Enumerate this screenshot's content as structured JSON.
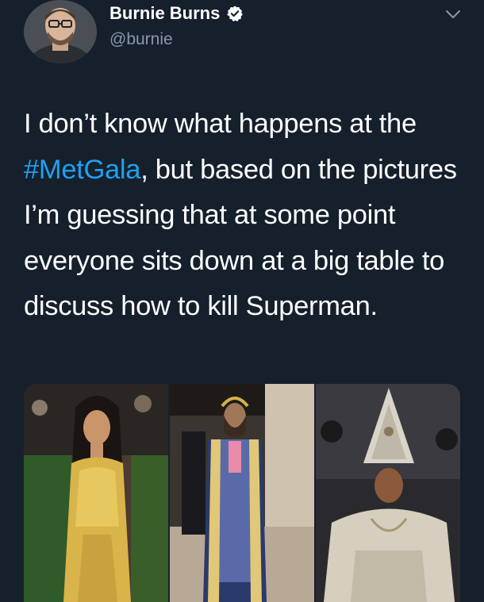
{
  "author": {
    "name": "Burnie Burns",
    "handle": "@burnie",
    "verified_icon": "verified-badge-icon",
    "avatar_icon": "profile-photo"
  },
  "menu": {
    "icon": "chevron-down-icon"
  },
  "tweet": {
    "text_before": "I don’t know what happens at the ",
    "hashtag": "#MetGala",
    "text_after": ", but based on the pictures I’m guessing that at some point everyone sits down at a big table to discuss how to kill Superman."
  },
  "media": {
    "photos": [
      {
        "subject": "woman-in-gold-gown-photo"
      },
      {
        "subject": "man-in-embroidered-robe-photo"
      },
      {
        "subject": "woman-in-jeweled-mitre-photo"
      }
    ]
  },
  "colors": {
    "background": "#16202c",
    "text": "#ffffff",
    "secondary_text": "#8899a6",
    "link": "#1da1f2"
  }
}
